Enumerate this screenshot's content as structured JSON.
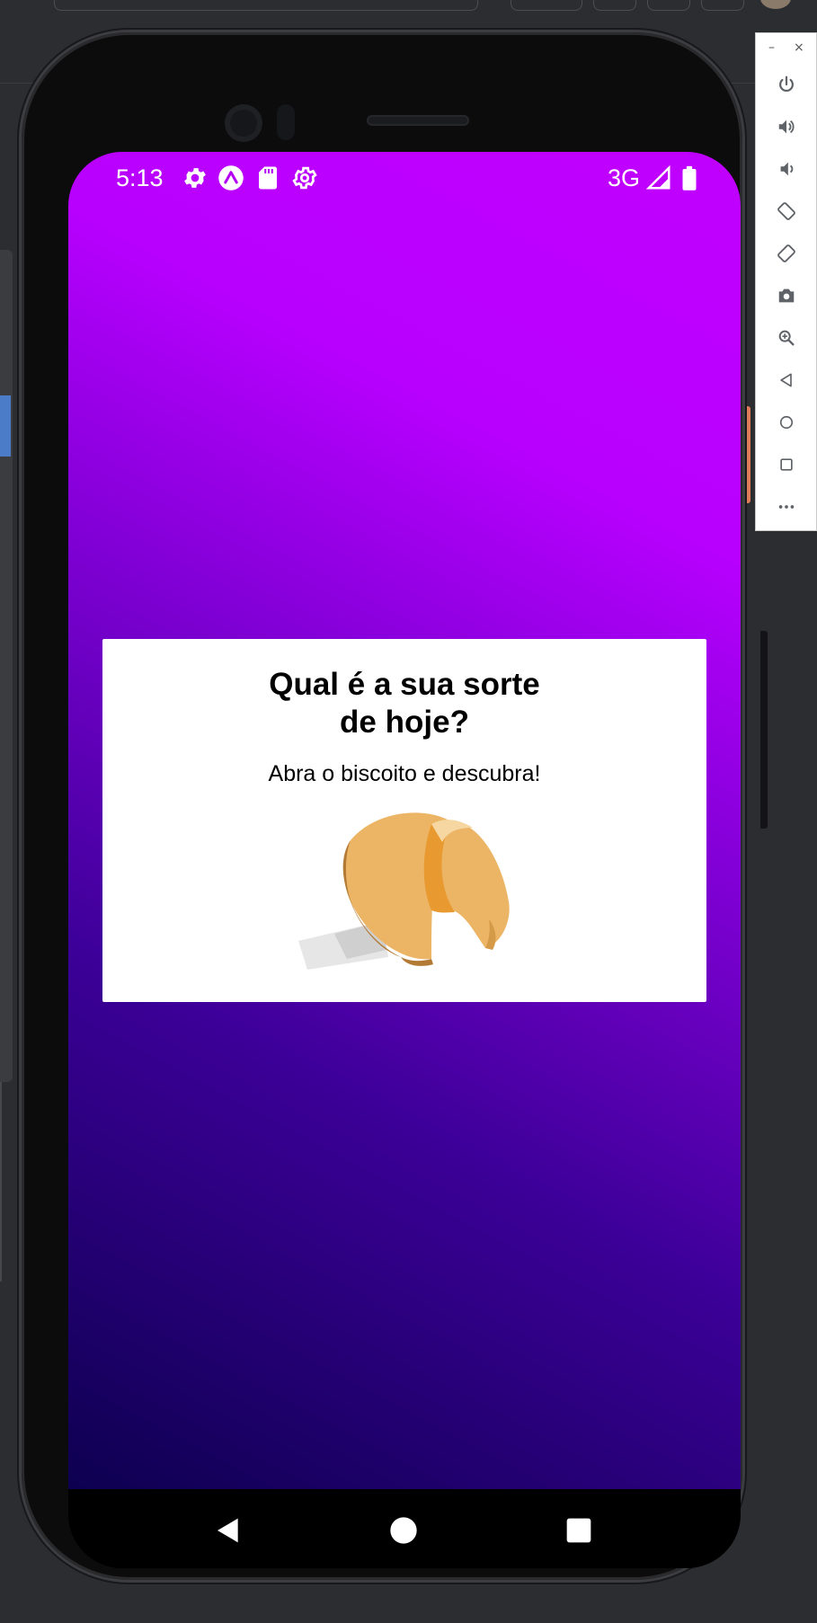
{
  "status_bar": {
    "time": "5:13",
    "network": "3G",
    "icons": [
      "settings-icon",
      "expo-icon",
      "sd-card-icon",
      "settings-outline-icon",
      "signal-icon",
      "battery-icon"
    ]
  },
  "app": {
    "title_line1": "Qual é a sua sorte",
    "title_line2": "de hoje?",
    "subtitle": "Abra o biscoito e descubra!",
    "image": "fortune-cookie",
    "colors": {
      "gradient_top": "#c100ff",
      "gradient_bottom": "#0d0050",
      "card": "#ffffff"
    }
  },
  "nav_bar": {
    "buttons": [
      "back-icon",
      "home-icon",
      "recents-icon"
    ]
  },
  "emulator_toolbar": {
    "minimize": "–",
    "close": "×",
    "buttons": [
      "power-icon",
      "volume-up-icon",
      "volume-down-icon",
      "rotate-left-icon",
      "rotate-right-icon",
      "camera-icon",
      "zoom-icon",
      "back-icon",
      "home-icon",
      "overview-icon",
      "more-icon"
    ]
  }
}
